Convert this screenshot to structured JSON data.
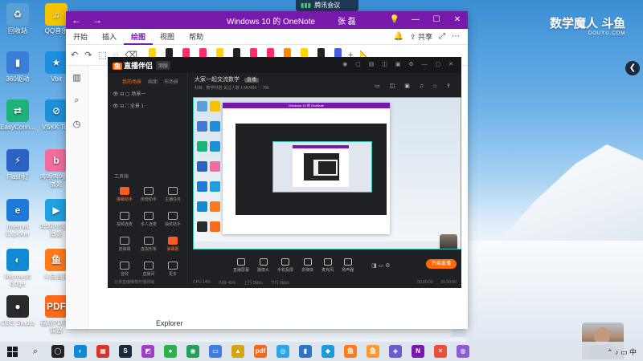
{
  "meeting_indicator": "腾讯会议",
  "stream_watermark": {
    "brand": "数学魔人",
    "site": "斗鱼",
    "domain": "DOUYU.COM"
  },
  "desktop_icons": [
    {
      "label": "回收站",
      "color": "#5aa0d8",
      "glyph": "♻"
    },
    {
      "label": "QQ音乐",
      "color": "#f5c400",
      "glyph": "♫"
    },
    {
      "label": "360驱动",
      "color": "#3b7dd8",
      "glyph": "▮"
    },
    {
      "label": "Vbit",
      "color": "#1b8fe0",
      "glyph": "★"
    },
    {
      "label": "EasyConn...",
      "color": "#1cb27a",
      "glyph": "⇄"
    },
    {
      "label": "VSKK Tab",
      "color": "#1e90d6",
      "glyph": "⊘"
    },
    {
      "label": "Flash打",
      "color": "#2a63c4",
      "glyph": "⚡"
    },
    {
      "label": "哔哩哔哩直播姬",
      "color": "#f06d9e",
      "glyph": "b"
    },
    {
      "label": "Internet Explorer",
      "color": "#1d7ad8",
      "glyph": "e"
    },
    {
      "label": "哔哩哔哩直播姬",
      "color": "#1fa0e0",
      "glyph": "▶"
    },
    {
      "label": "Microsoft Edge",
      "color": "#0f8bd6",
      "glyph": "◐"
    },
    {
      "label": "斗鱼直播",
      "color": "#ff7a1a",
      "glyph": "鱼"
    },
    {
      "label": "OBS Studio",
      "color": "#2a2a2a",
      "glyph": "●"
    },
    {
      "label": "福昕PDF编辑器",
      "color": "#ff6a1a",
      "glyph": "PDF"
    }
  ],
  "onenote": {
    "title": "Windows 10 的 OneNote",
    "user": "张 磊",
    "tabs": [
      "开始",
      "插入",
      "绘图",
      "视图",
      "帮助"
    ],
    "active_tab": "绘图",
    "share_label": "共享",
    "explorer_label": "Explorer",
    "pen_colors": [
      "#ffd400",
      "#222222",
      "#ff2d6b",
      "#ff2d6b",
      "#ffd400",
      "#222222",
      "#ff2d6b",
      "#ff2d6b",
      "#ff8a00",
      "#ffd400",
      "#222222",
      "#4b5cd8"
    ]
  },
  "stream_app": {
    "logo": "直播伴侣",
    "version": "测版",
    "left_tabs": [
      "我的场景",
      "画面",
      "布场景"
    ],
    "scenes": [
      "场景一",
      "全景 1"
    ],
    "tools_title": "工具箱",
    "tools": [
      {
        "label": "弹幕助手",
        "hot": true
      },
      {
        "label": "房管助手",
        "hot": false
      },
      {
        "label": "主播任务",
        "hot": false
      },
      {
        "label": "视频连麦",
        "hot": false
      },
      {
        "label": "多人连麦",
        "hot": false
      },
      {
        "label": "抽奖助手",
        "hot": false
      },
      {
        "label": "连弹幕",
        "hot": false
      },
      {
        "label": "虚拟形象",
        "hot": false
      },
      {
        "label": "弹幕姬",
        "hot": true
      },
      {
        "label": "音效",
        "hot": false
      },
      {
        "label": "直播间",
        "hot": false
      },
      {
        "label": "更多",
        "hot": false
      }
    ],
    "tip": "分类直播推荐开播领域",
    "room_title": "大家一起交流数学",
    "room_tag": "直播",
    "meta": "科目 · 数学科普   关注人数 1.6K/456   ♡ 786",
    "bottom_buttons": [
      "直播屏幕",
      "摄像头",
      "手机投屏",
      "多媒体",
      "麦克风",
      "扬声器"
    ],
    "start_label": "开始直播",
    "footer": [
      "CPU 14%",
      "内存 45%",
      "上行 0kb/s",
      "下行 0kb/s"
    ],
    "time_a": "00:00:00",
    "time_b": "00:00:50"
  },
  "taskbar": {
    "apps": [
      {
        "glyph": "◯",
        "color": "#222"
      },
      {
        "glyph": "◐",
        "color": "#0f8bd6"
      },
      {
        "glyph": "▦",
        "color": "#d9342b"
      },
      {
        "glyph": "S",
        "color": "#1b2a3a"
      },
      {
        "glyph": "◩",
        "color": "#a33ec9"
      },
      {
        "glyph": "●",
        "color": "#2cb24a"
      },
      {
        "glyph": "◉",
        "color": "#23a05a"
      },
      {
        "glyph": "▭",
        "color": "#3d7ee0"
      },
      {
        "glyph": "▲",
        "color": "#d4a417"
      },
      {
        "glyph": "pdf",
        "color": "#f06a1a"
      },
      {
        "glyph": "◎",
        "color": "#2aa6ea"
      },
      {
        "glyph": "▮",
        "color": "#2f72c9"
      },
      {
        "glyph": "◆",
        "color": "#1e9ad6"
      },
      {
        "glyph": "鱼",
        "color": "#ff7a1a"
      },
      {
        "glyph": "鱼",
        "color": "#ff9a2a"
      },
      {
        "glyph": "◈",
        "color": "#6d5bd0"
      },
      {
        "glyph": "N",
        "color": "#7719aa"
      },
      {
        "glyph": "✕",
        "color": "#e8503a"
      },
      {
        "glyph": "◍",
        "color": "#8a5cd6"
      }
    ],
    "tray_icons": "⌃ ♪ ▭ 中"
  }
}
